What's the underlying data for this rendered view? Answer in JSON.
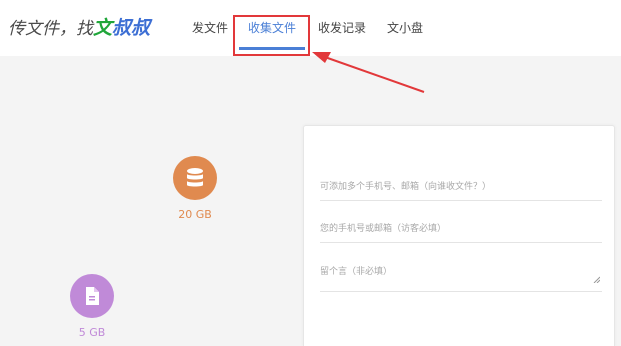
{
  "brand": {
    "prefix": "传文件，找",
    "wen": "文",
    "shushu": "叔叔"
  },
  "nav": {
    "items": [
      {
        "label": "发文件"
      },
      {
        "label": "收集文件"
      },
      {
        "label": "收发记录"
      },
      {
        "label": "文小盘"
      }
    ],
    "active_index": 1
  },
  "storage": [
    {
      "size": "20 GB",
      "icon": "database-icon",
      "color": "#e08a4f"
    },
    {
      "size": "5 GB",
      "icon": "document-icon",
      "color": "#c08ad8"
    }
  ],
  "form": {
    "recipients_placeholder": "可添加多个手机号、邮箱（向谁收文件？）",
    "contact_placeholder": "您的手机号或邮箱（访客必填）",
    "message_placeholder": "留个言（非必填）"
  },
  "colors": {
    "accent": "#4a7fd6",
    "annotation_red": "#e2383a",
    "brand_green": "#20a63a"
  }
}
